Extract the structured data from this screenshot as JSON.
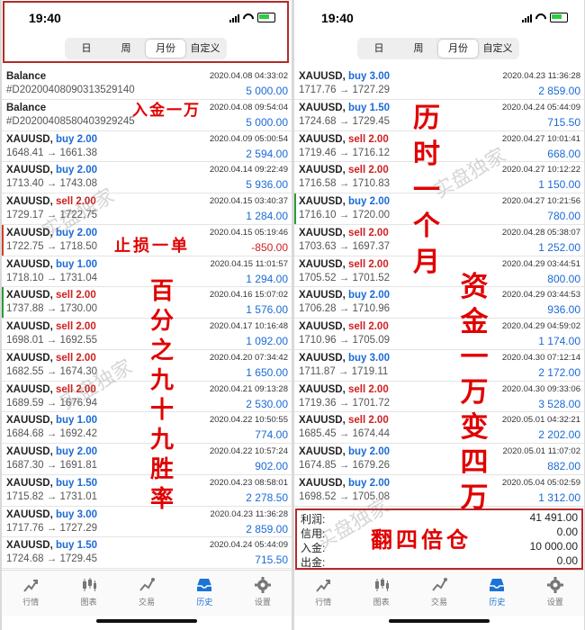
{
  "status_time": "19:40",
  "segments": [
    "日",
    "周",
    "月份",
    "自定义"
  ],
  "selected_segment": "月份",
  "tabs": [
    {
      "label": "行情",
      "icon": "chart-up-icon"
    },
    {
      "label": "图表",
      "icon": "candlestick-icon"
    },
    {
      "label": "交易",
      "icon": "trade-icon"
    },
    {
      "label": "历史",
      "icon": "history-inbox-icon"
    },
    {
      "label": "设置",
      "icon": "gear-icon"
    }
  ],
  "active_tab": "历史",
  "left_rows": [
    {
      "kind": "balance",
      "title": "Balance",
      "id": "#D20200408090313529140",
      "date": "2020.04.08 04:33:02",
      "amount": "5 000.00"
    },
    {
      "kind": "balance",
      "title": "Balance",
      "id": "#D20200408580403929245",
      "date": "2020.04.08 09:54:04",
      "amount": "5 000.00"
    },
    {
      "sym": "XAUUSD",
      "dir": "buy",
      "lots": "2.00",
      "open": "1648.41",
      "close": "1661.38",
      "date": "2020.04.09 05:00:54",
      "amount": "2 594.00"
    },
    {
      "sym": "XAUUSD",
      "dir": "buy",
      "lots": "2.00",
      "open": "1713.40",
      "close": "1743.08",
      "date": "2020.04.14 09:22:49",
      "amount": "5 936.00"
    },
    {
      "sym": "XAUUSD",
      "dir": "sell",
      "lots": "2.00",
      "open": "1729.17",
      "close": "1722.75",
      "date": "2020.04.15 03:40:37",
      "amount": "1 284.00"
    },
    {
      "sym": "XAUUSD",
      "dir": "buy",
      "lots": "2.00",
      "open": "1722.75",
      "close": "1718.50",
      "date": "2020.04.15 05:19:46",
      "amount": "-850.00",
      "border": "red"
    },
    {
      "sym": "XAUUSD",
      "dir": "buy",
      "lots": "1.00",
      "open": "1718.10",
      "close": "1731.04",
      "date": "2020.04.15 11:01:57",
      "amount": "1 294.00"
    },
    {
      "sym": "XAUUSD",
      "dir": "sell",
      "lots": "2.00",
      "open": "1737.88",
      "close": "1730.00",
      "date": "2020.04.16 15:07:02",
      "amount": "1 576.00",
      "border": "green"
    },
    {
      "sym": "XAUUSD",
      "dir": "sell",
      "lots": "2.00",
      "open": "1698.01",
      "close": "1692.55",
      "date": "2020.04.17 10:16:48",
      "amount": "1 092.00"
    },
    {
      "sym": "XAUUSD",
      "dir": "sell",
      "lots": "2.00",
      "open": "1682.55",
      "close": "1674.30",
      "date": "2020.04.20 07:34:42",
      "amount": "1 650.00"
    },
    {
      "sym": "XAUUSD",
      "dir": "sell",
      "lots": "2.00",
      "open": "1689.59",
      "close": "1676.94",
      "date": "2020.04.21 09:13:28",
      "amount": "2 530.00"
    },
    {
      "sym": "XAUUSD",
      "dir": "buy",
      "lots": "1.00",
      "open": "1684.68",
      "close": "1692.42",
      "date": "2020.04.22 10:50:55",
      "amount": "774.00"
    },
    {
      "sym": "XAUUSD",
      "dir": "buy",
      "lots": "2.00",
      "open": "1687.30",
      "close": "1691.81",
      "date": "2020.04.22 10:57:24",
      "amount": "902.00"
    },
    {
      "sym": "XAUUSD",
      "dir": "buy",
      "lots": "1.50",
      "open": "1715.82",
      "close": "1731.01",
      "date": "2020.04.23 08:58:01",
      "amount": "2 278.50"
    },
    {
      "sym": "XAUUSD",
      "dir": "buy",
      "lots": "3.00",
      "open": "1717.76",
      "close": "1727.29",
      "date": "2020.04.23 11:36:28",
      "amount": "2 859.00"
    },
    {
      "sym": "XAUUSD",
      "dir": "buy",
      "lots": "1.50",
      "open": "1724.68",
      "close": "1729.45",
      "date": "2020.04.24 05:44:09",
      "amount": "715.50"
    }
  ],
  "right_rows": [
    {
      "sym": "XAUUSD",
      "dir": "buy",
      "lots": "3.00",
      "open": "1717.76",
      "close": "1727.29",
      "date": "2020.04.23 11:36:28",
      "amount": "2 859.00"
    },
    {
      "sym": "XAUUSD",
      "dir": "buy",
      "lots": "1.50",
      "open": "1724.68",
      "close": "1729.45",
      "date": "2020.04.24 05:44:09",
      "amount": "715.50"
    },
    {
      "sym": "XAUUSD",
      "dir": "sell",
      "lots": "2.00",
      "open": "1719.46",
      "close": "1716.12",
      "date": "2020.04.27 10:01:41",
      "amount": "668.00"
    },
    {
      "sym": "XAUUSD",
      "dir": "sell",
      "lots": "2.00",
      "open": "1716.58",
      "close": "1710.83",
      "date": "2020.04.27 10:12:22",
      "amount": "1 150.00"
    },
    {
      "sym": "XAUUSD",
      "dir": "buy",
      "lots": "2.00",
      "open": "1716.10",
      "close": "1720.00",
      "date": "2020.04.27 10:21:56",
      "amount": "780.00",
      "border": "green"
    },
    {
      "sym": "XAUUSD",
      "dir": "sell",
      "lots": "2.00",
      "open": "1703.63",
      "close": "1697.37",
      "date": "2020.04.28 05:38:07",
      "amount": "1 252.00"
    },
    {
      "sym": "XAUUSD",
      "dir": "sell",
      "lots": "2.00",
      "open": "1705.52",
      "close": "1701.52",
      "date": "2020.04.29 03:44:51",
      "amount": "800.00"
    },
    {
      "sym": "XAUUSD",
      "dir": "buy",
      "lots": "2.00",
      "open": "1706.28",
      "close": "1710.96",
      "date": "2020.04.29 03:44:53",
      "amount": "936.00"
    },
    {
      "sym": "XAUUSD",
      "dir": "sell",
      "lots": "2.00",
      "open": "1710.96",
      "close": "1705.09",
      "date": "2020.04.29 04:59:02",
      "amount": "1 174.00"
    },
    {
      "sym": "XAUUSD",
      "dir": "buy",
      "lots": "3.00",
      "open": "1711.87",
      "close": "1719.11",
      "date": "2020.04.30 07:12:14",
      "amount": "2 172.00"
    },
    {
      "sym": "XAUUSD",
      "dir": "sell",
      "lots": "2.00",
      "open": "1719.36",
      "close": "1701.72",
      "date": "2020.04.30 09:33:06",
      "amount": "3 528.00"
    },
    {
      "sym": "XAUUSD",
      "dir": "sell",
      "lots": "2.00",
      "open": "1685.45",
      "close": "1674.44",
      "date": "2020.05.01 04:32:21",
      "amount": "2 202.00"
    },
    {
      "sym": "XAUUSD",
      "dir": "buy",
      "lots": "2.00",
      "open": "1674.85",
      "close": "1679.26",
      "date": "2020.05.01 11:07:02",
      "amount": "882.00"
    },
    {
      "sym": "XAUUSD",
      "dir": "buy",
      "lots": "2.00",
      "open": "1698.52",
      "close": "1705.08",
      "date": "2020.05.04 05:02:59",
      "amount": "1 312.00"
    }
  ],
  "summary": [
    {
      "label": "利润:",
      "value": "41 491.00"
    },
    {
      "label": "信用:",
      "value": "0.00"
    },
    {
      "label": "入金:",
      "value": "10 000.00"
    },
    {
      "label": "出金:",
      "value": "0.00"
    }
  ],
  "annotations": {
    "deposit": "入金一万",
    "stoploss": "止损一单",
    "winrate": "百分之九十九胜率",
    "duration": "历时一个月",
    "capital": "资金一万变四万",
    "quadruple": "翻四倍仓"
  },
  "watermark": "实盘独家",
  "colors": {
    "buy": "#1b6ad6",
    "sell": "#d02020",
    "annotation": "#e00000",
    "box": "#b32b2b",
    "active_tab": "#1b73d8"
  }
}
